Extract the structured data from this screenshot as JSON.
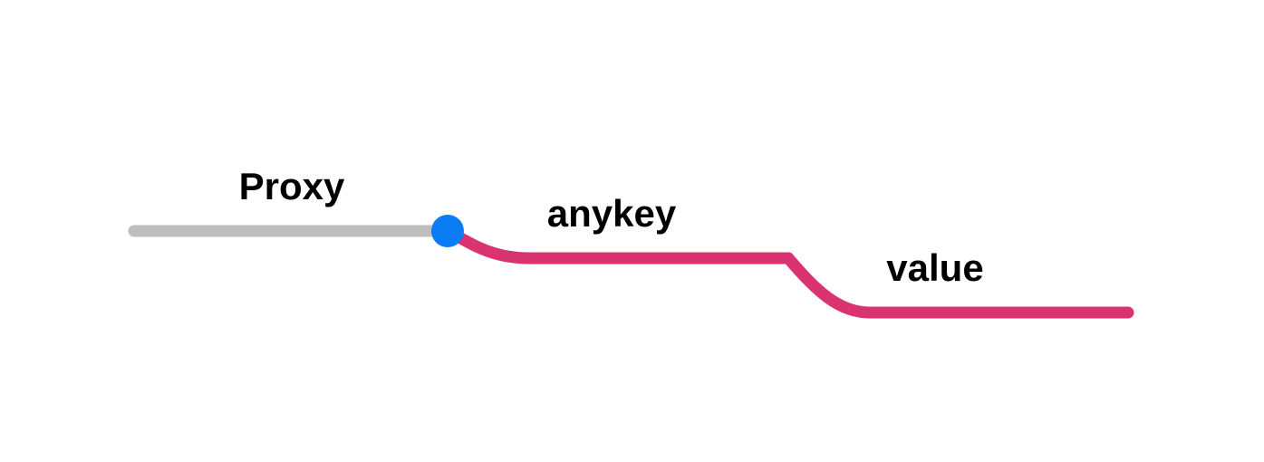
{
  "diagram": {
    "labels": {
      "proxy": "Proxy",
      "anykey": "anykey",
      "value": "value"
    },
    "colors": {
      "proxy_line": "#bebebe",
      "path_line": "#d9346f",
      "node": "#0a7cf4",
      "text": "#000000"
    }
  }
}
